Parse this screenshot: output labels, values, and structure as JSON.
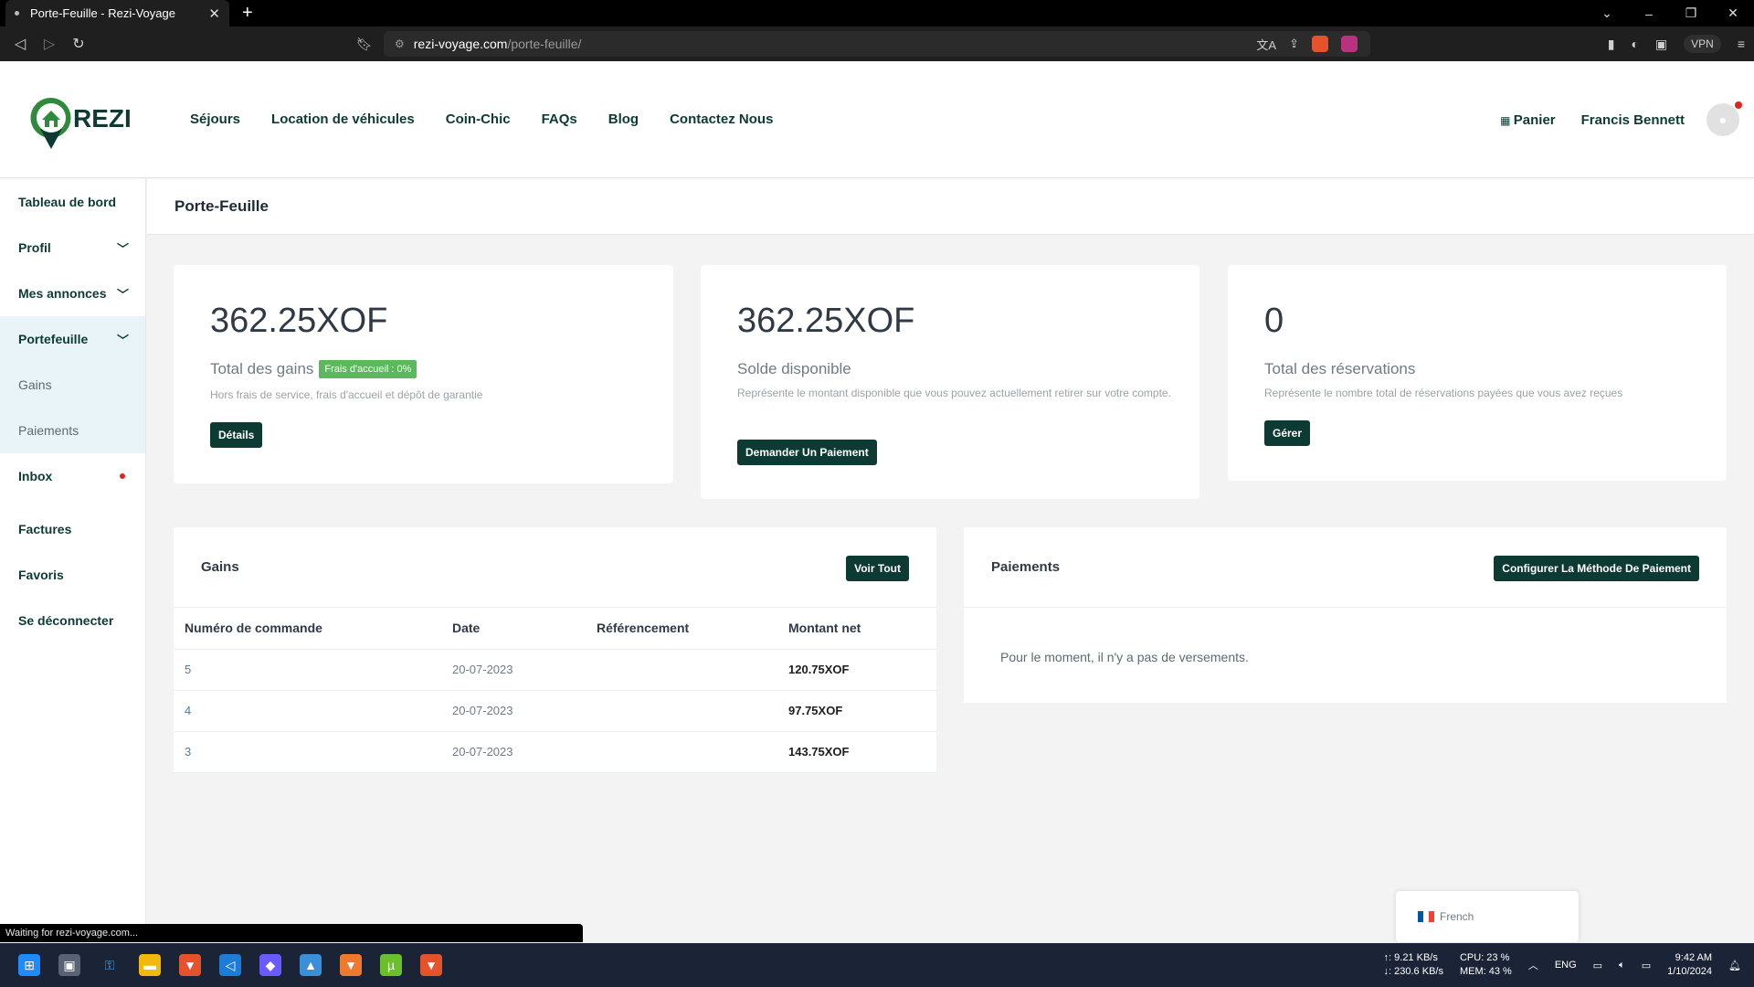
{
  "browser": {
    "tab_title": "Porte-Feuille - Rezi-Voyage",
    "url_host": "rezi-voyage.com",
    "url_path": "/porte-feuille/",
    "vpn_label": "VPN",
    "status_text": "Waiting for rezi-voyage.com..."
  },
  "site": {
    "logo_text": "REZI",
    "brand_color": "#0d3b34",
    "nav": [
      "Séjours",
      "Location de véhicules",
      "Coin-Chic",
      "FAQs",
      "Blog",
      "Contactez Nous"
    ],
    "cart_label": "Panier",
    "user_name": "Francis Bennett"
  },
  "sidebar": {
    "items": [
      {
        "label": "Tableau de bord"
      },
      {
        "label": "Profil"
      },
      {
        "label": "Mes annonces"
      },
      {
        "label": "Portefeuille"
      },
      {
        "label": "Gains"
      },
      {
        "label": "Paiements"
      },
      {
        "label": "Inbox"
      },
      {
        "label": "Factures"
      },
      {
        "label": "Favoris"
      },
      {
        "label": "Se déconnecter"
      }
    ]
  },
  "page": {
    "title": "Porte-Feuille"
  },
  "cards": {
    "earnings": {
      "amount": "362.25XOF",
      "label": "Total des gains",
      "badge": "Frais d'accueil : 0%",
      "desc": "Hors frais de service, frais d'accueil et dépôt de garantie",
      "button": "Détails"
    },
    "balance": {
      "amount": "362.25XOF",
      "label": "Solde disponible",
      "desc": "Représente le montant disponible que vous pouvez actuellement retirer sur votre compte.",
      "button": "Demander Un Paiement"
    },
    "bookings": {
      "amount": "0",
      "label": "Total des réservations",
      "desc": "Représente le nombre total de réservations payées que vous avez reçues",
      "button": "Gérer"
    }
  },
  "gains_panel": {
    "title": "Gains",
    "button": "Voir Tout",
    "columns": [
      "Numéro de commande",
      "Date",
      "Référencement",
      "Montant net"
    ],
    "rows": [
      {
        "order": "5",
        "date": "20-07-2023",
        "ref": "",
        "amount": "120.75XOF"
      },
      {
        "order": "4",
        "date": "20-07-2023",
        "ref": "",
        "amount": "97.75XOF"
      },
      {
        "order": "3",
        "date": "20-07-2023",
        "ref": "",
        "amount": "143.75XOF"
      }
    ]
  },
  "payments_panel": {
    "title": "Paiements",
    "button": "Configurer La Méthode De Paiement",
    "empty_text": "Pour le moment, il n'y a pas de versements."
  },
  "language": {
    "label": "French"
  },
  "taskbar": {
    "net_up": "↑: 9.21 KB/s",
    "net_down": "↓: 230.6 KB/s",
    "cpu": "CPU: 23 %",
    "mem": "MEM: 43 %",
    "lang": "ENG",
    "time": "9:42 AM",
    "date": "1/10/2024"
  }
}
